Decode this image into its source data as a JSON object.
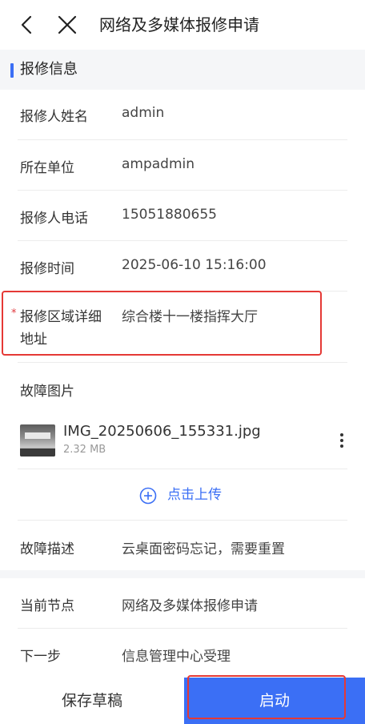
{
  "header": {
    "title": "网络及多媒体报修申请",
    "back_icon": "chevron-left-icon",
    "close_icon": "close-icon"
  },
  "section": {
    "title": "报修信息",
    "accent_color": "#3b6ff5"
  },
  "fields": {
    "reporter_name": {
      "label": "报修人姓名",
      "value": "admin"
    },
    "unit": {
      "label": "所在单位",
      "value": "ampadmin"
    },
    "phone": {
      "label": "报修人电话",
      "value": "15051880655"
    },
    "time": {
      "label": "报修时间",
      "value": "2025-06-10 15:16:00"
    },
    "address": {
      "label_line1": "报修区域详细",
      "label_line2": "地址",
      "value": "综合楼十一楼指挥大厅",
      "required_mark": "*"
    },
    "photos": {
      "label": "故障图片"
    },
    "description": {
      "label": "故障描述",
      "value": "云桌面密码忘记，需要重置"
    },
    "current_node": {
      "label": "当前节点",
      "value": "网络及多媒体报修申请"
    },
    "next_step": {
      "label": "下一步",
      "value": "信息管理中心受理"
    }
  },
  "attachment": {
    "file_name": "IMG_20250606_155331.jpg",
    "file_size": "2.32 MB",
    "more_icon": "more-vertical-icon"
  },
  "upload": {
    "label": "点击上传",
    "icon": "plus-circle-icon"
  },
  "footer": {
    "draft_label": "保存草稿",
    "start_label": "启动",
    "primary_color": "#3b6ff5",
    "highlight_color": "#e53935"
  }
}
